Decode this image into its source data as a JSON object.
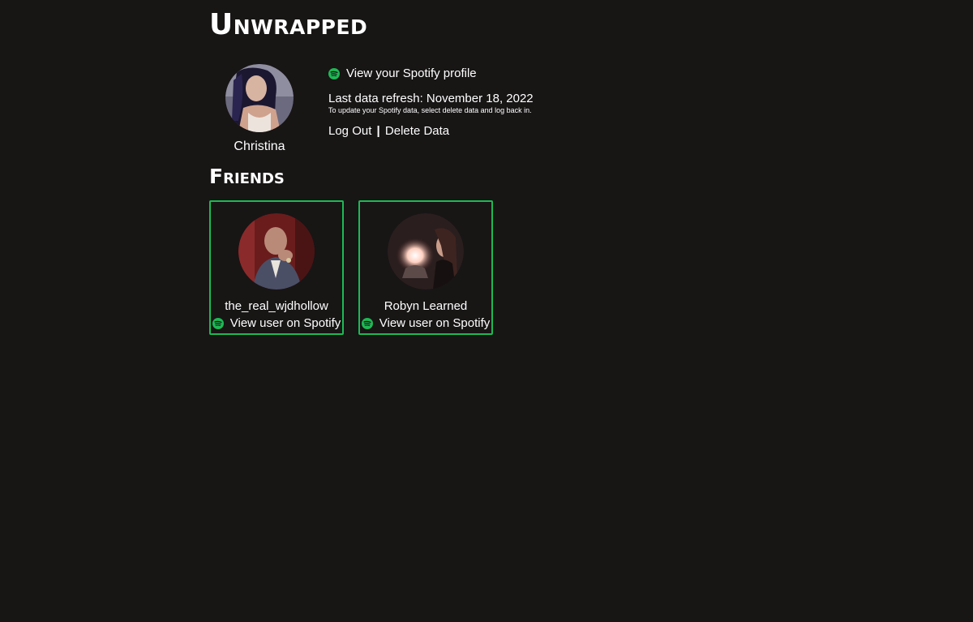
{
  "app": {
    "title": "Unwrapped"
  },
  "profile": {
    "name": "Christina",
    "spotify_link_label": "View your Spotify profile",
    "last_refresh": "Last data refresh: November 18, 2022",
    "refresh_note": "To update your Spotify data, select delete data and log back in.",
    "log_out_label": "Log Out",
    "separator": "|",
    "delete_label": "Delete Data"
  },
  "friends_section": {
    "title": "Friends"
  },
  "friends": [
    {
      "name": "the_real_wjdhollow",
      "link_label": "View user on Spotify"
    },
    {
      "name": "Robyn Learned",
      "link_label": "View user on Spotify"
    }
  ],
  "colors": {
    "background": "#181515",
    "accent": "#1db954",
    "text": "#ffffff"
  },
  "icons": {
    "spotify": "spotify-icon"
  }
}
